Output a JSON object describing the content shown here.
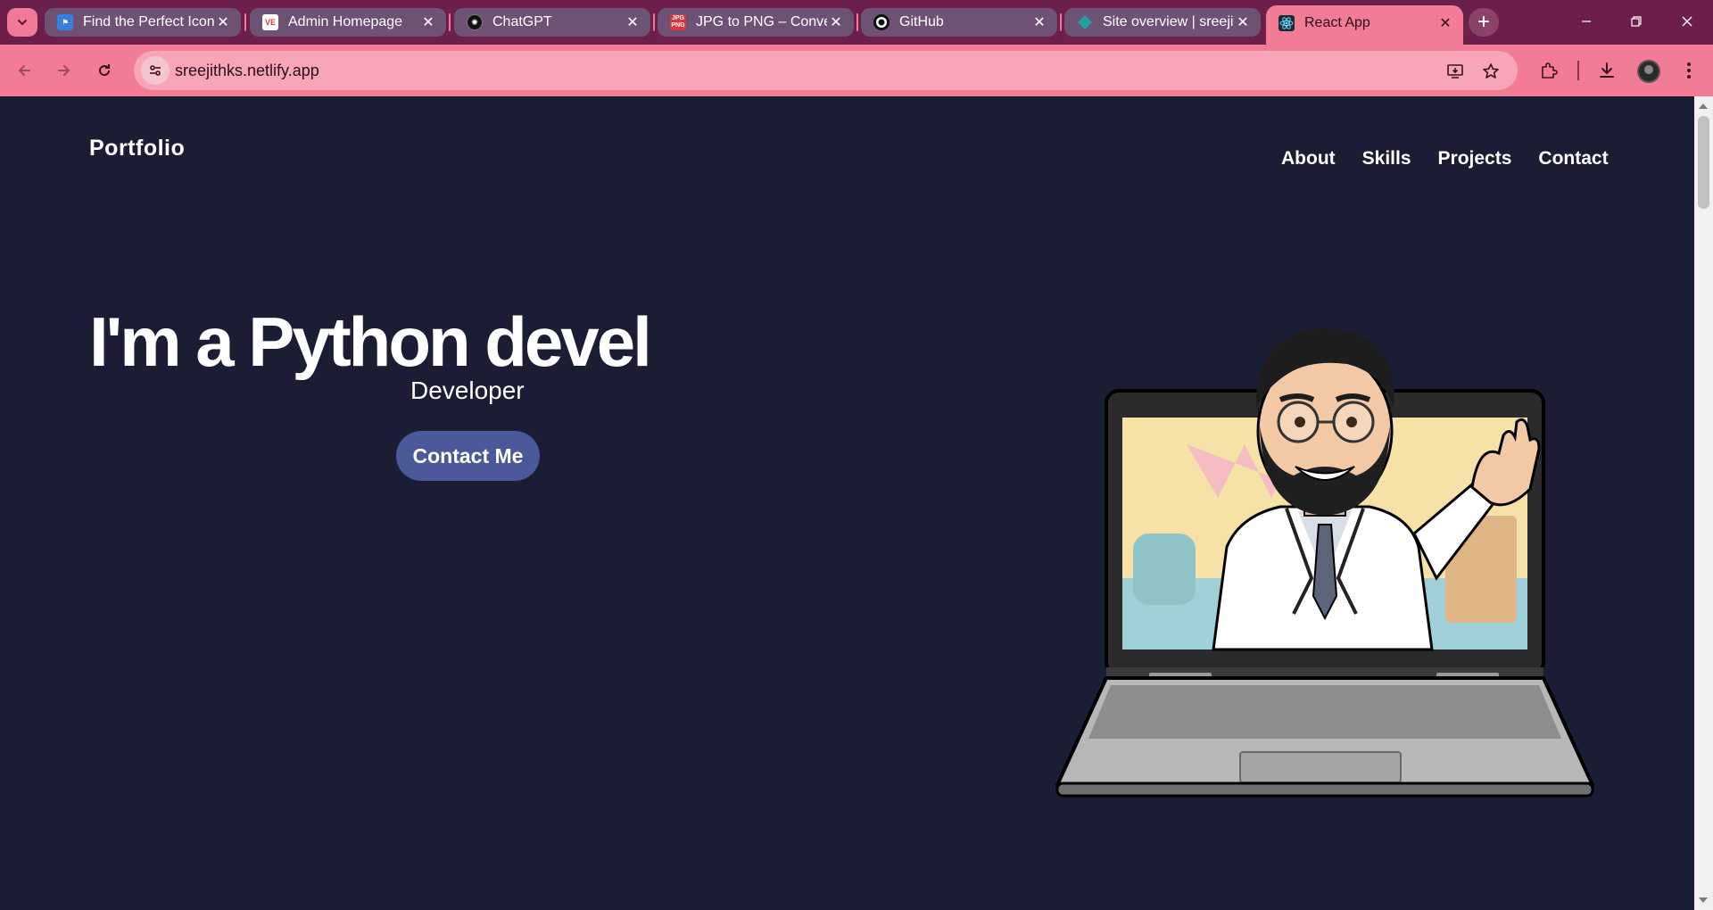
{
  "browser": {
    "tabs": [
      {
        "title": "Find the Perfect Icon",
        "favicon": "flag-icon",
        "color": "#3b7ddd"
      },
      {
        "title": "Admin Homepage",
        "favicon": "ve-logo-icon",
        "color": "#e03c3c"
      },
      {
        "title": "ChatGPT",
        "favicon": "openai-icon",
        "color": "#111111"
      },
      {
        "title": "JPG to PNG – Conver",
        "favicon": "jpg-png-icon",
        "color": "#d9363e"
      },
      {
        "title": "GitHub",
        "favicon": "github-icon",
        "color": "#111111"
      },
      {
        "title": "Site overview | sreejit",
        "favicon": "netlify-icon",
        "color": "#22a3a0"
      },
      {
        "title": "React App",
        "favicon": "react-icon",
        "color": "#1c2a38"
      }
    ],
    "active_tab_index": 6,
    "url": "sreejithks.netlify.app"
  },
  "page": {
    "brand": "Portfolio",
    "nav": [
      "About",
      "Skills",
      "Projects",
      "Contact"
    ],
    "hero_title": "I'm a Python devel",
    "hero_subtitle": "Developer",
    "cta_label": "Contact Me"
  },
  "colors": {
    "page_bg": "#1a1d33",
    "button_bg": "#4b5899",
    "chrome_accent": "#f27b95",
    "chrome_dark": "#6b1f4a"
  }
}
